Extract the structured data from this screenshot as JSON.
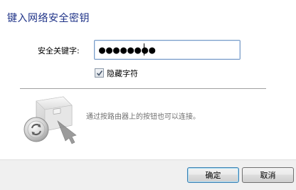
{
  "dialog": {
    "title": "键入网络安全密钥",
    "key_label": "安全关键字:",
    "key_value": "●●●●●●●●",
    "hide_characters_label": "隐藏字符",
    "hide_characters_checked": true,
    "router_hint": "通过按路由器上的按钮也可以连接。",
    "router_icon": "router-wps-icon"
  },
  "buttons": {
    "ok_label": "确定",
    "cancel_label": "取消"
  }
}
